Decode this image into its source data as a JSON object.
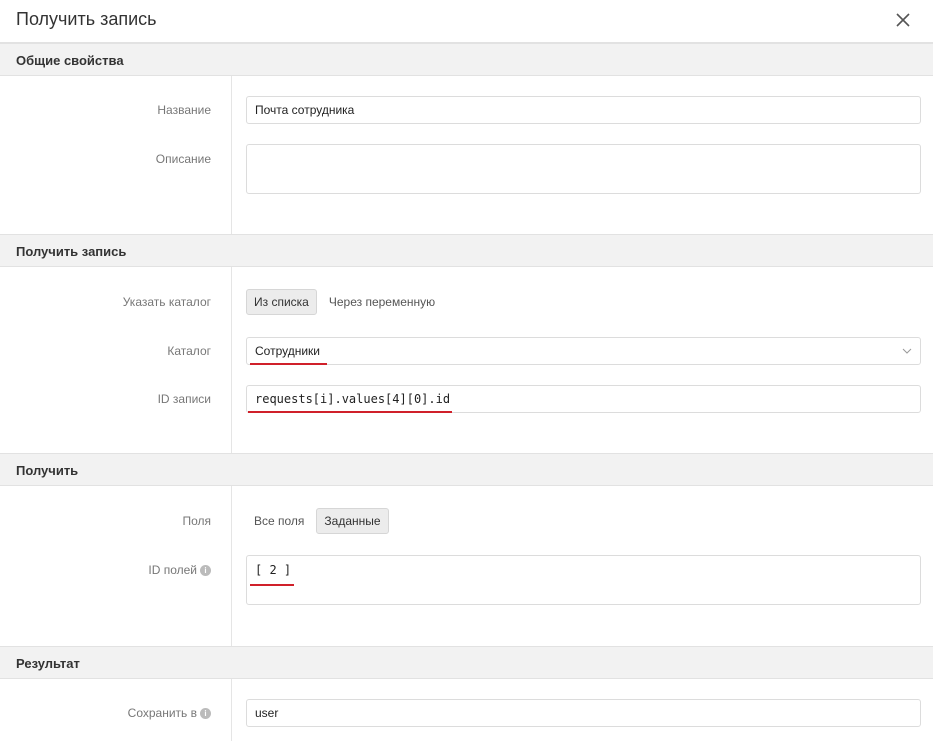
{
  "dialog": {
    "title": "Получить запись",
    "close_icon": "close-icon"
  },
  "general": {
    "header": "Общие свойства",
    "name_label": "Название",
    "name_value": "Почта сотрудника",
    "description_label": "Описание",
    "description_value": ""
  },
  "get_record": {
    "header": "Получить запись",
    "catalog_mode_label": "Указать каталог",
    "catalog_mode_options": [
      "Из списка",
      "Через переменную"
    ],
    "catalog_label": "Каталог",
    "catalog_value": "Сотрудники",
    "record_id_label": "ID записи",
    "record_id_value": "requests[i].values[4][0].id"
  },
  "get": {
    "header": "Получить",
    "fields_label": "Поля",
    "fields_options": [
      "Все поля",
      "Заданные"
    ],
    "field_ids_label": "ID полей",
    "field_ids_value": "[ 2 ]"
  },
  "result": {
    "header": "Результат",
    "save_to_label": "Сохранить в",
    "save_to_value": "user"
  },
  "colors": {
    "underline": "#d0202a",
    "header_bg": "#f2f2f2"
  }
}
